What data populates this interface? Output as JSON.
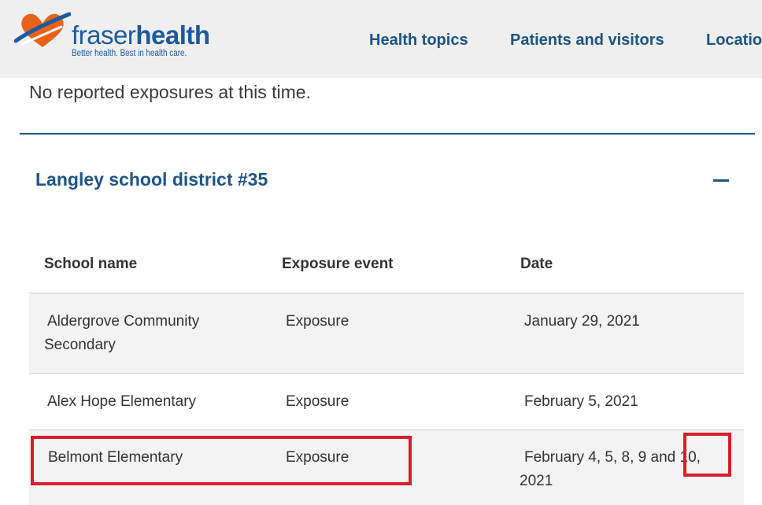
{
  "header": {
    "brand_part1": "fraser",
    "brand_part2": "health",
    "tagline": "Better health. Best in health care.",
    "nav": [
      "Health topics",
      "Patients and visitors",
      "Locatio"
    ]
  },
  "notice": "No reported exposures at this time.",
  "section": {
    "title": "Langley school district #35",
    "toggle_icon": "minus-icon"
  },
  "table": {
    "headers": [
      "School name",
      "Exposure event",
      "Date"
    ],
    "rows": [
      {
        "school_line1": "Aldergrove Community",
        "school_line2": "Secondary",
        "event": "Exposure",
        "date": "January 29, 2021"
      },
      {
        "school": "Alex Hope Elementary",
        "event": "Exposure",
        "date": "February 5, 2021"
      },
      {
        "school": "Belmont Elementary",
        "event": "Exposure",
        "date_line1": "February 4, 5, 8, 9 and 10,",
        "date_line2": "2021"
      }
    ]
  },
  "colors": {
    "brand_blue": "#1c5486",
    "logo_orange": "#e8621a",
    "highlight_red": "#d91e2a"
  }
}
